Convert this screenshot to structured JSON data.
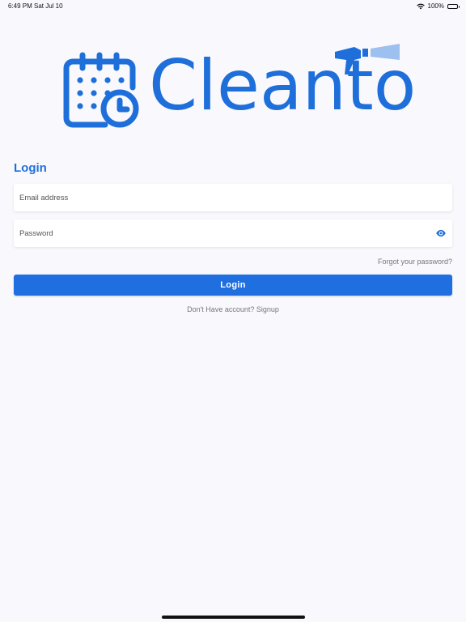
{
  "status_bar": {
    "time": "6:49 PM",
    "date": "Sat Jul 10",
    "battery": "100%",
    "icons": [
      "wifi-icon",
      "battery-icon"
    ]
  },
  "logo": {
    "wordmark": "Cleanto",
    "icons": [
      "calendar-clock-icon",
      "spray-bottle-icon"
    ],
    "color": "#1f6fdb"
  },
  "login": {
    "title": "Login",
    "email_placeholder": "Email address",
    "password_placeholder": "Password",
    "forgot_label": "Forgot your password?",
    "button_label": "Login",
    "signup_prompt": "Don't Have account?",
    "signup_link": "Signup"
  },
  "colors": {
    "accent": "#1f6fe0",
    "background": "#f9f9fd"
  }
}
